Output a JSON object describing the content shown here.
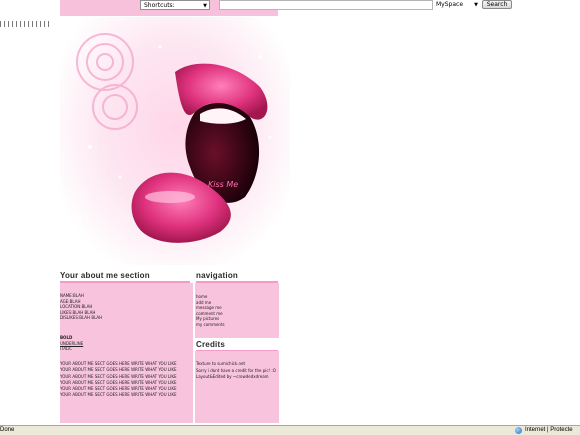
{
  "toolbar": {
    "shortcuts_label": "Shortcuts:",
    "scope_label": "MySpace",
    "search_label": "Search",
    "search_value": ""
  },
  "artwork": {
    "caption": "Kiss Me"
  },
  "about": {
    "title": "Your about me section",
    "facts": [
      "NAME:BLAH",
      "AGE:BLAH",
      "LOCATION:BLAH",
      "LIKES:BLAH BLAH",
      "DISLIKES:BLAH BLAH"
    ],
    "styles": {
      "bold": "BOLD",
      "underline": "UNDERLINE",
      "italic": "ITALIC"
    },
    "repeat_lines": [
      "YOUR ABOUT ME SECT GOES HERE WRITE WHAT YOU LIKE",
      "YOUR ABOUT ME SECT GOES HERE WRITE WHAT YOU LIKE",
      "YOUR ABOUT ME SECT GOES HERE WRITE WHAT YOU LIKE",
      "YOUR ABOUT ME SECT GOES HERE WRITE WHAT YOU LIKE",
      "YOUR ABOUT ME SECT GOES HERE WRITE WHAT YOU LIKE",
      "YOUR ABOUT ME SECT GOES HERE WRITE WHAT YOU LIKE"
    ]
  },
  "navigation": {
    "title": "navigation",
    "links": [
      "home",
      "add me",
      "message me",
      "comment me",
      "My pictures",
      "my comments"
    ]
  },
  "credits": {
    "title": "Credits",
    "lines": [
      "Texture to sumichick.net",
      "Sorry i dont have a credit for the pic! :O",
      "Layout&Edited by ~crowdedxdream"
    ]
  },
  "status_bar": {
    "status": "Done",
    "zone": "Internet | Protecte"
  },
  "colors": {
    "panel_pink": "#f8c3dd",
    "accent_pink": "#f49bc7",
    "lip_pink": "#e0337f"
  }
}
